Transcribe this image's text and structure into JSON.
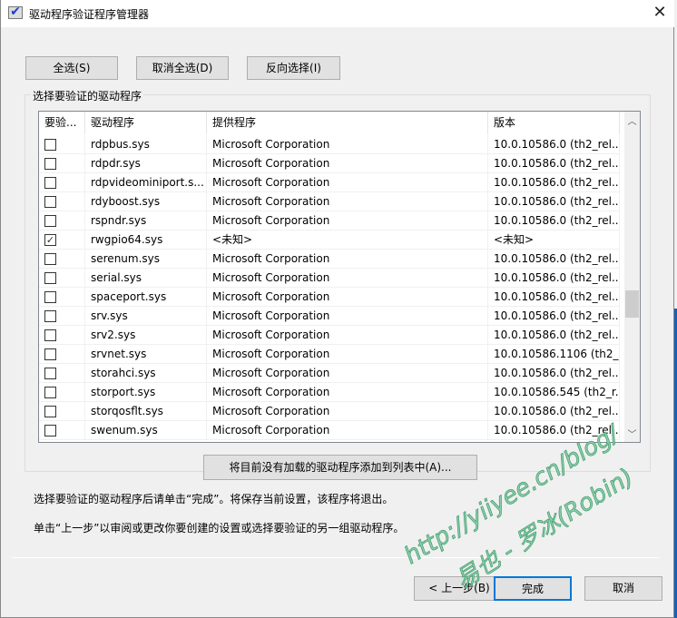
{
  "window": {
    "title": "驱动程序验证程序管理器",
    "close": "✕"
  },
  "toolbar": {
    "select_all": "全选(S)",
    "deselect_all": "取消全选(D)",
    "invert": "反向选择(I)"
  },
  "group_label": "选择要验证的驱动程序",
  "columns": [
    "要验...",
    "驱动程序",
    "提供程序",
    "版本"
  ],
  "rows": [
    {
      "checked": false,
      "driver": "rdpbus.sys",
      "provider": "Microsoft Corporation",
      "version": "10.0.10586.0 (th2_rel..."
    },
    {
      "checked": false,
      "driver": "rdpdr.sys",
      "provider": "Microsoft Corporation",
      "version": "10.0.10586.0 (th2_rel..."
    },
    {
      "checked": false,
      "driver": "rdpvideominiport.s...",
      "provider": "Microsoft Corporation",
      "version": "10.0.10586.0 (th2_rel..."
    },
    {
      "checked": false,
      "driver": "rdyboost.sys",
      "provider": "Microsoft Corporation",
      "version": "10.0.10586.0 (th2_rel..."
    },
    {
      "checked": false,
      "driver": "rspndr.sys",
      "provider": "Microsoft Corporation",
      "version": "10.0.10586.0 (th2_rel..."
    },
    {
      "checked": true,
      "driver": "rwgpio64.sys",
      "provider": "<未知>",
      "version": "<未知>"
    },
    {
      "checked": false,
      "driver": "serenum.sys",
      "provider": "Microsoft Corporation",
      "version": "10.0.10586.0 (th2_rel..."
    },
    {
      "checked": false,
      "driver": "serial.sys",
      "provider": "Microsoft Corporation",
      "version": "10.0.10586.0 (th2_rel..."
    },
    {
      "checked": false,
      "driver": "spaceport.sys",
      "provider": "Microsoft Corporation",
      "version": "10.0.10586.0 (th2_rel..."
    },
    {
      "checked": false,
      "driver": "srv.sys",
      "provider": "Microsoft Corporation",
      "version": "10.0.10586.0 (th2_rel..."
    },
    {
      "checked": false,
      "driver": "srv2.sys",
      "provider": "Microsoft Corporation",
      "version": "10.0.10586.0 (th2_rel..."
    },
    {
      "checked": false,
      "driver": "srvnet.sys",
      "provider": "Microsoft Corporation",
      "version": "10.0.10586.1106 (th2_..."
    },
    {
      "checked": false,
      "driver": "storahci.sys",
      "provider": "Microsoft Corporation",
      "version": "10.0.10586.0 (th2_rel..."
    },
    {
      "checked": false,
      "driver": "storport.sys",
      "provider": "Microsoft Corporation",
      "version": "10.0.10586.545 (th2_r..."
    },
    {
      "checked": false,
      "driver": "storqosflt.sys",
      "provider": "Microsoft Corporation",
      "version": "10.0.10586.0 (th2_rel..."
    },
    {
      "checked": false,
      "driver": "swenum.sys",
      "provider": "Microsoft Corporation",
      "version": "10.0.10586.0 (th2_rel..."
    }
  ],
  "scroll_position": 0.6,
  "add_button": "将目前没有加载的驱动程序添加到列表中(A)...",
  "info1": "选择要验证的驱动程序后请单击“完成”。将保存当前设置，该程序将退出。",
  "info2": "单击“上一步”以审阅或更改你要创建的设置或选择要验证的另一组驱动程序。",
  "footer": {
    "back": "< 上一步(B)",
    "finish": "完成",
    "cancel": "取消"
  },
  "watermark": [
    "http://yiiyee.cn/blog/",
    "易也 - 罗冰(Robin)"
  ]
}
